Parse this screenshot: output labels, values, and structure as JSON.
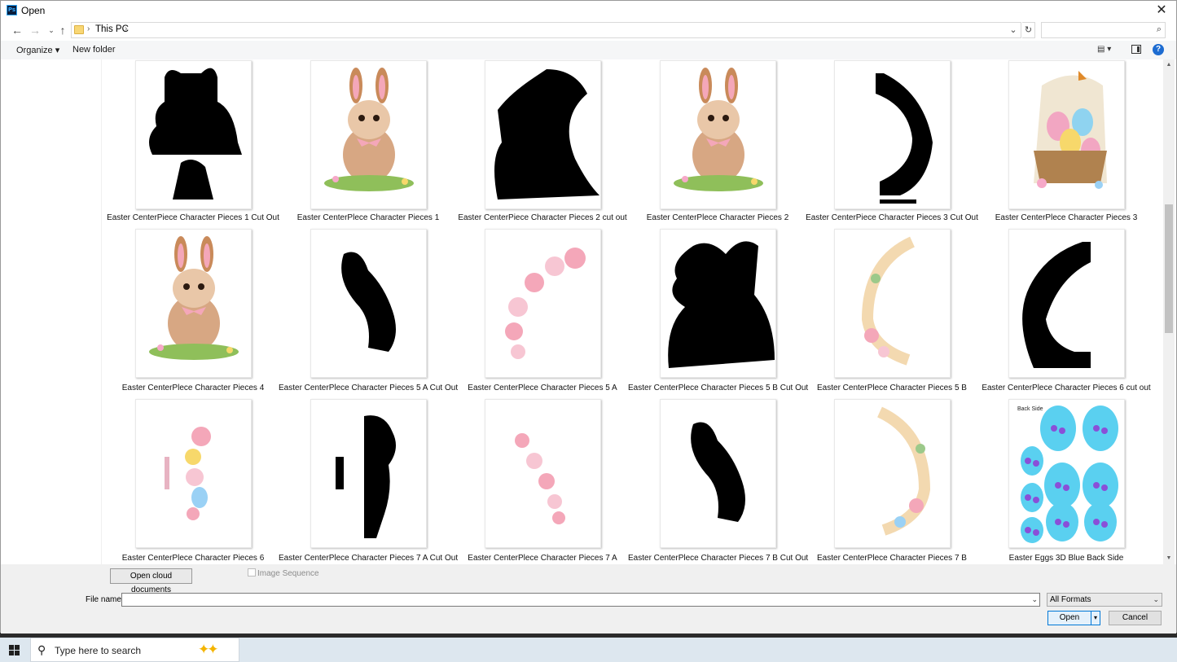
{
  "window": {
    "title": "Open",
    "app_icon": "Ps",
    "close_glyph": "✕"
  },
  "navigation": {
    "back_icon": "arrow-left-icon",
    "forward_icon": "arrow-right-icon",
    "recent_icon": "chevron-down-icon",
    "up_icon": "arrow-up-icon",
    "breadcrumb": [
      "This PC"
    ],
    "search_placeholder": ""
  },
  "toolbar": {
    "organize_label": "Organize ▾",
    "new_folder_label": "New folder",
    "help_glyph": "?"
  },
  "files": [
    {
      "name": "Easter CenterPiece Character Pieces 1 Cut Out",
      "thumb": "silhouette"
    },
    {
      "name": "Easter CenterPlece Character Pieces 1",
      "thumb": "bunny"
    },
    {
      "name": "Easter CenterPiece Character Pieces 2 cut out",
      "thumb": "silhouette"
    },
    {
      "name": "Easter CenterPlece Character Pieces 2",
      "thumb": "bunny"
    },
    {
      "name": "Easter CenterPiece Character Pieces 3 Cut Out",
      "thumb": "silhouette"
    },
    {
      "name": "Easter CenterPlece Character Pieces 3",
      "thumb": "basket"
    },
    {
      "name": "Easter CenterPlece Character Pieces 4",
      "thumb": "bunny"
    },
    {
      "name": "Easter CenterPlece Character Pieces 5 A Cut Out",
      "thumb": "silhouette"
    },
    {
      "name": "Easter CenterPlece Character Pieces 5 A",
      "thumb": "floral"
    },
    {
      "name": "Easter CenterPlece Character Pieces 5 B Cut Out",
      "thumb": "silhouette"
    },
    {
      "name": "Easter CenterPlece Character Pieces 5 B",
      "thumb": "floral"
    },
    {
      "name": "Easter CenterPlece Character Pieces 6 cut out",
      "thumb": "silhouette"
    },
    {
      "name": "Easter CenterPlece Character Pieces 6",
      "thumb": "floral"
    },
    {
      "name": "Easter CenterPlece Character Pieces 7 A Cut Out",
      "thumb": "silhouette"
    },
    {
      "name": "Easter CenterPlece Character Pieces 7 A",
      "thumb": "floral"
    },
    {
      "name": "Easter CenterPlece Character Pieces 7 B Cut Out",
      "thumb": "silhouette"
    },
    {
      "name": "Easter CenterPlece Character Pieces 7 B",
      "thumb": "floral"
    },
    {
      "name": "Easter Eggs 3D Blue Back Side",
      "thumb": "eggs",
      "thumb_text": "Back Side"
    }
  ],
  "footer": {
    "cloud_button": "Open cloud documents",
    "image_sequence_label": "Image Sequence",
    "file_name_label": "File name:",
    "file_name_value": "",
    "format_value": "All Formats",
    "open_button": "Open",
    "cancel_button": "Cancel"
  },
  "taskbar": {
    "search_text": "Type here to search",
    "sparkle": "✦✦"
  },
  "colors": {
    "accent": "#0078d7",
    "silhouette": "#000000",
    "egg_blue": "#5ad0f0",
    "egg_purple": "#8a4fd8",
    "bunny_pink": "#f4a7b9",
    "bunny_brown": "#c98a5a"
  }
}
